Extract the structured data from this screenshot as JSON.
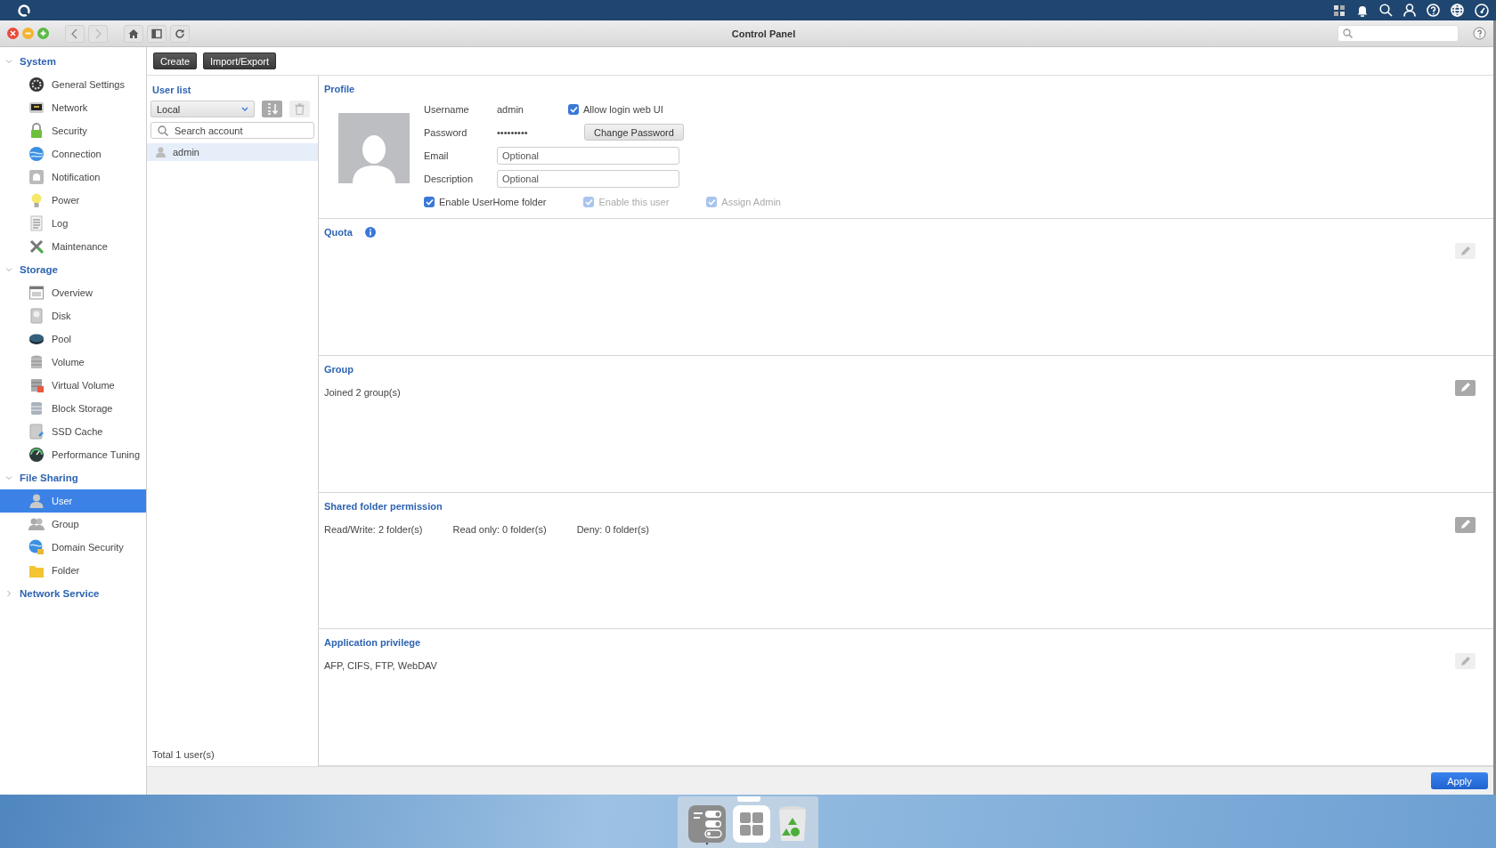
{
  "window": {
    "title": "Control Panel"
  },
  "sidebar": {
    "groups": [
      {
        "label": "System",
        "expanded": true,
        "items": [
          {
            "label": "General Settings",
            "selected": false
          },
          {
            "label": "Network",
            "selected": false
          },
          {
            "label": "Security",
            "selected": false
          },
          {
            "label": "Connection",
            "selected": false
          },
          {
            "label": "Notification",
            "selected": false
          },
          {
            "label": "Power",
            "selected": false
          },
          {
            "label": "Log",
            "selected": false
          },
          {
            "label": "Maintenance",
            "selected": false
          }
        ]
      },
      {
        "label": "Storage",
        "expanded": true,
        "items": [
          {
            "label": "Overview",
            "selected": false
          },
          {
            "label": "Disk",
            "selected": false
          },
          {
            "label": "Pool",
            "selected": false
          },
          {
            "label": "Volume",
            "selected": false
          },
          {
            "label": "Virtual Volume",
            "selected": false
          },
          {
            "label": "Block Storage",
            "selected": false
          },
          {
            "label": "SSD Cache",
            "selected": false
          },
          {
            "label": "Performance Tuning",
            "selected": false
          }
        ]
      },
      {
        "label": "File Sharing",
        "expanded": true,
        "items": [
          {
            "label": "User",
            "selected": true
          },
          {
            "label": "Group",
            "selected": false
          },
          {
            "label": "Domain Security",
            "selected": false
          },
          {
            "label": "Folder",
            "selected": false
          }
        ]
      },
      {
        "label": "Network Service",
        "expanded": false
      }
    ]
  },
  "toolbar": {
    "buttons": [
      "Create",
      "Import/Export"
    ]
  },
  "user_list": {
    "title": "User list",
    "source": "Local",
    "search": {
      "placeholder": "Search account"
    },
    "users": [
      {
        "name": "admin",
        "selected": true
      }
    ],
    "footer": "Total 1 user(s)"
  },
  "profile": {
    "title": "Profile",
    "username": {
      "label": "Username",
      "value": "admin"
    },
    "allow_login": {
      "label": "Allow login web UI",
      "checked": true,
      "disabled": false
    },
    "password": {
      "label": "Password",
      "value": "•••••••••"
    },
    "change_password": "Change Password",
    "email": {
      "label": "Email",
      "placeholder": "Optional"
    },
    "description": {
      "label": "Description",
      "placeholder": "Optional"
    },
    "options": [
      {
        "label": "Enable UserHome folder",
        "checked": true,
        "disabled": false
      },
      {
        "label": "Enable this user",
        "checked": true,
        "disabled": true
      },
      {
        "label": "Assign Admin",
        "checked": true,
        "disabled": true
      }
    ]
  },
  "sections": [
    {
      "title": "Quota",
      "info": true,
      "edit_disabled": true
    },
    {
      "title": "Group",
      "info": false,
      "texts": [
        "Joined 2 group(s)"
      ],
      "edit_disabled": false
    },
    {
      "title": "Shared folder permission",
      "info": false,
      "texts": [
        "Read/Write: 2 folder(s)",
        "Read only: 0 folder(s)",
        "Deny: 0 folder(s)"
      ],
      "edit_disabled": false
    },
    {
      "title": "Application privilege",
      "info": false,
      "texts": [
        "AFP, CIFS, FTP, WebDAV"
      ],
      "edit_disabled": true
    }
  ],
  "footer": {
    "button": "Apply"
  }
}
